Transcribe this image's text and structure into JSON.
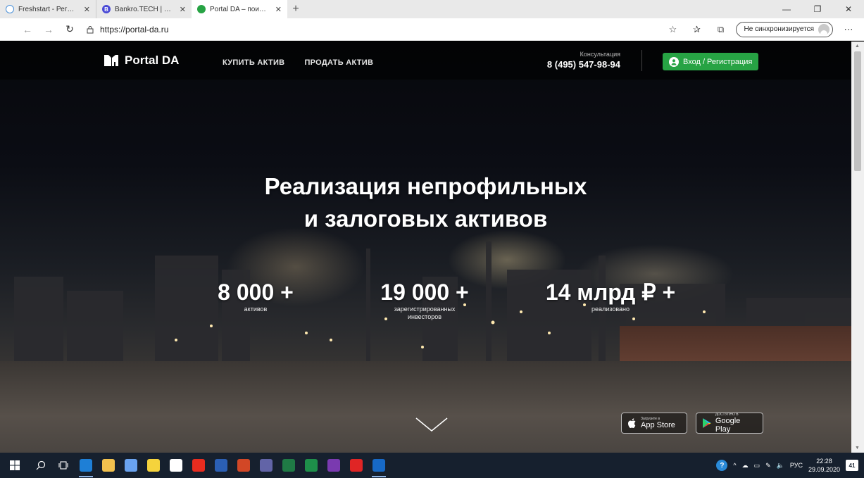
{
  "browser": {
    "tabs": [
      {
        "title": "Freshstart - Регистрация нового",
        "active": false,
        "favicon_color": "#ffffff"
      },
      {
        "title": "Bankro.TECH | Единая система п",
        "active": false,
        "favicon_color": "#4a4ad6"
      },
      {
        "title": "Portal DA – поиск и размещени",
        "active": true,
        "favicon_color": "#27a344"
      }
    ],
    "new_tab": "+",
    "address": "https://portal-da.ru",
    "sync_label": "Не синхронизируется",
    "window_controls": {
      "minimize": "—",
      "maximize": "❐",
      "close": "✕"
    }
  },
  "site": {
    "logo_text": "Portal DA",
    "nav": [
      "КУПИТЬ АКТИВ",
      "ПРОДАТЬ АКТИВ"
    ],
    "consult_label": "Консультация",
    "phone": "8 (495) 547-98-94",
    "login_label": "Вход / Регистрация",
    "accent_color": "#27a344",
    "hero_title_line1": "Реализация непрофильных",
    "hero_title_line2": "и залоговых активов",
    "stats": [
      {
        "value": "8 000 +",
        "caption1": "активов",
        "caption2": ""
      },
      {
        "value": "19 000 +",
        "caption1": "зарегистрированных",
        "caption2": "инвесторов"
      },
      {
        "value": "14 млрд ₽ +",
        "caption1": "реализовано",
        "caption2": ""
      }
    ],
    "app_store": {
      "small": "Загрузите в",
      "big": "App Store"
    },
    "google_play": {
      "small": "ДОСТУПНО В",
      "big": "Google Play"
    }
  },
  "taskbar": {
    "apps": [
      {
        "name": "edge",
        "color": "#1e7fd6",
        "active": true
      },
      {
        "name": "explorer",
        "color": "#f2c14e",
        "active": false
      },
      {
        "name": "dropbox",
        "color": "#6aa3f0",
        "active": false
      },
      {
        "name": "winamp",
        "color": "#f5d33c",
        "active": false
      },
      {
        "name": "yandex-browser",
        "color": "#ffffff",
        "active": false
      },
      {
        "name": "yandex",
        "color": "#e82c1f",
        "active": false
      },
      {
        "name": "word",
        "color": "#2b5fb4",
        "active": false
      },
      {
        "name": "powerpoint",
        "color": "#d24726",
        "active": false
      },
      {
        "name": "teams",
        "color": "#6264a7",
        "active": false
      },
      {
        "name": "excel",
        "color": "#1f7a45",
        "active": false
      },
      {
        "name": "skype-business",
        "color": "#1e8f4a",
        "active": false
      },
      {
        "name": "onenote",
        "color": "#7a3ab0",
        "active": false
      },
      {
        "name": "acrobat",
        "color": "#e02525",
        "active": false
      },
      {
        "name": "outlook",
        "color": "#1769c6",
        "active": true
      }
    ],
    "language": "РУС",
    "time": "22:28",
    "date": "29.09.2020",
    "notifications": "41"
  }
}
